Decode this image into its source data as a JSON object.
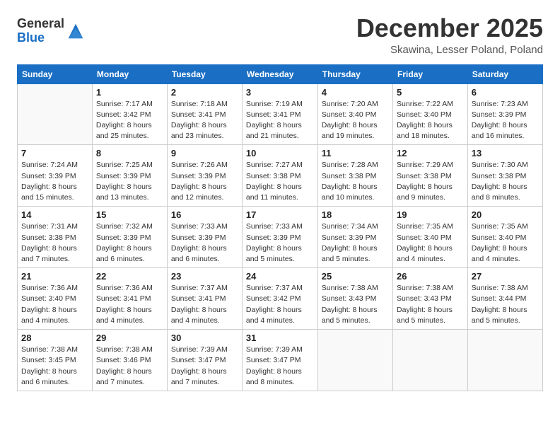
{
  "logo": {
    "general": "General",
    "blue": "Blue"
  },
  "header": {
    "month": "December 2025",
    "location": "Skawina, Lesser Poland, Poland"
  },
  "days_of_week": [
    "Sunday",
    "Monday",
    "Tuesday",
    "Wednesday",
    "Thursday",
    "Friday",
    "Saturday"
  ],
  "weeks": [
    [
      {
        "day": "",
        "sunrise": "",
        "sunset": "",
        "daylight": ""
      },
      {
        "day": "1",
        "sunrise": "Sunrise: 7:17 AM",
        "sunset": "Sunset: 3:42 PM",
        "daylight": "Daylight: 8 hours and 25 minutes."
      },
      {
        "day": "2",
        "sunrise": "Sunrise: 7:18 AM",
        "sunset": "Sunset: 3:41 PM",
        "daylight": "Daylight: 8 hours and 23 minutes."
      },
      {
        "day": "3",
        "sunrise": "Sunrise: 7:19 AM",
        "sunset": "Sunset: 3:41 PM",
        "daylight": "Daylight: 8 hours and 21 minutes."
      },
      {
        "day": "4",
        "sunrise": "Sunrise: 7:20 AM",
        "sunset": "Sunset: 3:40 PM",
        "daylight": "Daylight: 8 hours and 19 minutes."
      },
      {
        "day": "5",
        "sunrise": "Sunrise: 7:22 AM",
        "sunset": "Sunset: 3:40 PM",
        "daylight": "Daylight: 8 hours and 18 minutes."
      },
      {
        "day": "6",
        "sunrise": "Sunrise: 7:23 AM",
        "sunset": "Sunset: 3:39 PM",
        "daylight": "Daylight: 8 hours and 16 minutes."
      }
    ],
    [
      {
        "day": "7",
        "sunrise": "Sunrise: 7:24 AM",
        "sunset": "Sunset: 3:39 PM",
        "daylight": "Daylight: 8 hours and 15 minutes."
      },
      {
        "day": "8",
        "sunrise": "Sunrise: 7:25 AM",
        "sunset": "Sunset: 3:39 PM",
        "daylight": "Daylight: 8 hours and 13 minutes."
      },
      {
        "day": "9",
        "sunrise": "Sunrise: 7:26 AM",
        "sunset": "Sunset: 3:39 PM",
        "daylight": "Daylight: 8 hours and 12 minutes."
      },
      {
        "day": "10",
        "sunrise": "Sunrise: 7:27 AM",
        "sunset": "Sunset: 3:38 PM",
        "daylight": "Daylight: 8 hours and 11 minutes."
      },
      {
        "day": "11",
        "sunrise": "Sunrise: 7:28 AM",
        "sunset": "Sunset: 3:38 PM",
        "daylight": "Daylight: 8 hours and 10 minutes."
      },
      {
        "day": "12",
        "sunrise": "Sunrise: 7:29 AM",
        "sunset": "Sunset: 3:38 PM",
        "daylight": "Daylight: 8 hours and 9 minutes."
      },
      {
        "day": "13",
        "sunrise": "Sunrise: 7:30 AM",
        "sunset": "Sunset: 3:38 PM",
        "daylight": "Daylight: 8 hours and 8 minutes."
      }
    ],
    [
      {
        "day": "14",
        "sunrise": "Sunrise: 7:31 AM",
        "sunset": "Sunset: 3:38 PM",
        "daylight": "Daylight: 8 hours and 7 minutes."
      },
      {
        "day": "15",
        "sunrise": "Sunrise: 7:32 AM",
        "sunset": "Sunset: 3:39 PM",
        "daylight": "Daylight: 8 hours and 6 minutes."
      },
      {
        "day": "16",
        "sunrise": "Sunrise: 7:33 AM",
        "sunset": "Sunset: 3:39 PM",
        "daylight": "Daylight: 8 hours and 6 minutes."
      },
      {
        "day": "17",
        "sunrise": "Sunrise: 7:33 AM",
        "sunset": "Sunset: 3:39 PM",
        "daylight": "Daylight: 8 hours and 5 minutes."
      },
      {
        "day": "18",
        "sunrise": "Sunrise: 7:34 AM",
        "sunset": "Sunset: 3:39 PM",
        "daylight": "Daylight: 8 hours and 5 minutes."
      },
      {
        "day": "19",
        "sunrise": "Sunrise: 7:35 AM",
        "sunset": "Sunset: 3:40 PM",
        "daylight": "Daylight: 8 hours and 4 minutes."
      },
      {
        "day": "20",
        "sunrise": "Sunrise: 7:35 AM",
        "sunset": "Sunset: 3:40 PM",
        "daylight": "Daylight: 8 hours and 4 minutes."
      }
    ],
    [
      {
        "day": "21",
        "sunrise": "Sunrise: 7:36 AM",
        "sunset": "Sunset: 3:40 PM",
        "daylight": "Daylight: 8 hours and 4 minutes."
      },
      {
        "day": "22",
        "sunrise": "Sunrise: 7:36 AM",
        "sunset": "Sunset: 3:41 PM",
        "daylight": "Daylight: 8 hours and 4 minutes."
      },
      {
        "day": "23",
        "sunrise": "Sunrise: 7:37 AM",
        "sunset": "Sunset: 3:41 PM",
        "daylight": "Daylight: 8 hours and 4 minutes."
      },
      {
        "day": "24",
        "sunrise": "Sunrise: 7:37 AM",
        "sunset": "Sunset: 3:42 PM",
        "daylight": "Daylight: 8 hours and 4 minutes."
      },
      {
        "day": "25",
        "sunrise": "Sunrise: 7:38 AM",
        "sunset": "Sunset: 3:43 PM",
        "daylight": "Daylight: 8 hours and 5 minutes."
      },
      {
        "day": "26",
        "sunrise": "Sunrise: 7:38 AM",
        "sunset": "Sunset: 3:43 PM",
        "daylight": "Daylight: 8 hours and 5 minutes."
      },
      {
        "day": "27",
        "sunrise": "Sunrise: 7:38 AM",
        "sunset": "Sunset: 3:44 PM",
        "daylight": "Daylight: 8 hours and 5 minutes."
      }
    ],
    [
      {
        "day": "28",
        "sunrise": "Sunrise: 7:38 AM",
        "sunset": "Sunset: 3:45 PM",
        "daylight": "Daylight: 8 hours and 6 minutes."
      },
      {
        "day": "29",
        "sunrise": "Sunrise: 7:38 AM",
        "sunset": "Sunset: 3:46 PM",
        "daylight": "Daylight: 8 hours and 7 minutes."
      },
      {
        "day": "30",
        "sunrise": "Sunrise: 7:39 AM",
        "sunset": "Sunset: 3:47 PM",
        "daylight": "Daylight: 8 hours and 7 minutes."
      },
      {
        "day": "31",
        "sunrise": "Sunrise: 7:39 AM",
        "sunset": "Sunset: 3:47 PM",
        "daylight": "Daylight: 8 hours and 8 minutes."
      },
      {
        "day": "",
        "sunrise": "",
        "sunset": "",
        "daylight": ""
      },
      {
        "day": "",
        "sunrise": "",
        "sunset": "",
        "daylight": ""
      },
      {
        "day": "",
        "sunrise": "",
        "sunset": "",
        "daylight": ""
      }
    ]
  ]
}
